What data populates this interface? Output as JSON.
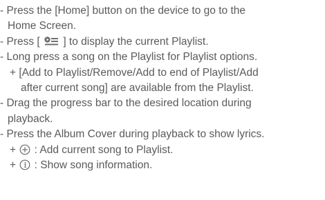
{
  "lines": [
    {
      "text_a": "- Press the [Home] button on the device to go to the"
    },
    {
      "text_a": "Home Screen."
    },
    {
      "text_a": "- Press [ ",
      "text_b": " ] to display the current Playlist.",
      "icon": "playlist-icon"
    },
    {
      "text_a": "- Long press a song on the Playlist for Playlist options."
    },
    {
      "text_a": "+ [Add to Playlist/Remove/Add to end of Playlist/Add"
    },
    {
      "text_a": "after current song] are available from the Playlist."
    },
    {
      "text_a": "- Drag the progress bar to the desired location during"
    },
    {
      "text_a": "playback."
    },
    {
      "text_a": "- Press the Album Cover during playback to show lyrics."
    },
    {
      "text_a": "+ ",
      "text_b": " : Add current song to Playlist.",
      "icon": "add-circle-icon"
    },
    {
      "text_a": "+ ",
      "text_b": " : Show song information.",
      "icon": "info-circle-icon"
    }
  ],
  "text_color": "#5a5a5a"
}
